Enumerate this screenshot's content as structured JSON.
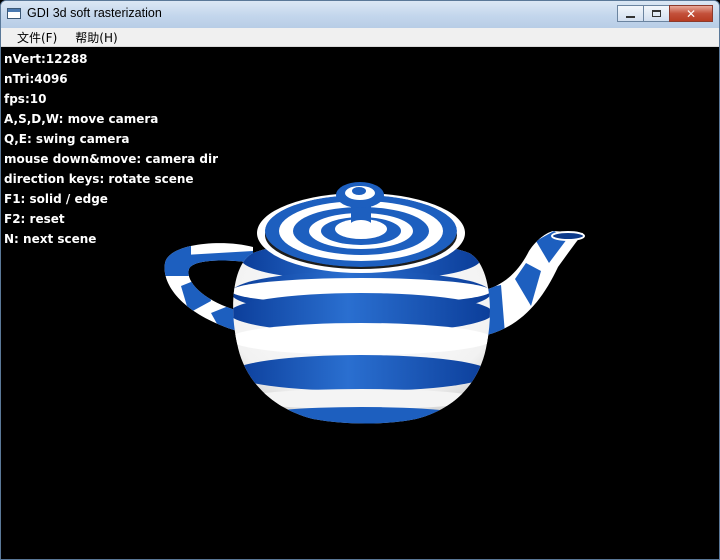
{
  "window": {
    "title": "GDI 3d soft rasterization"
  },
  "menu": {
    "items": [
      "文件(F)",
      "帮助(H)"
    ]
  },
  "hud": {
    "lines": [
      "nVert:12288",
      "nTri:4096",
      "fps:10",
      "A,S,D,W: move camera",
      "Q,E: swing camera",
      "mouse down&move: camera dir",
      "direction keys: rotate scene",
      "F1: solid / edge",
      "F2: reset",
      "N: next scene"
    ]
  },
  "scene": {
    "object": "teapot",
    "colors": {
      "stripe": "#1d5fbf",
      "stripe_dark": "#0d3a8a",
      "white": "#ffffff",
      "background": "#000000"
    }
  }
}
